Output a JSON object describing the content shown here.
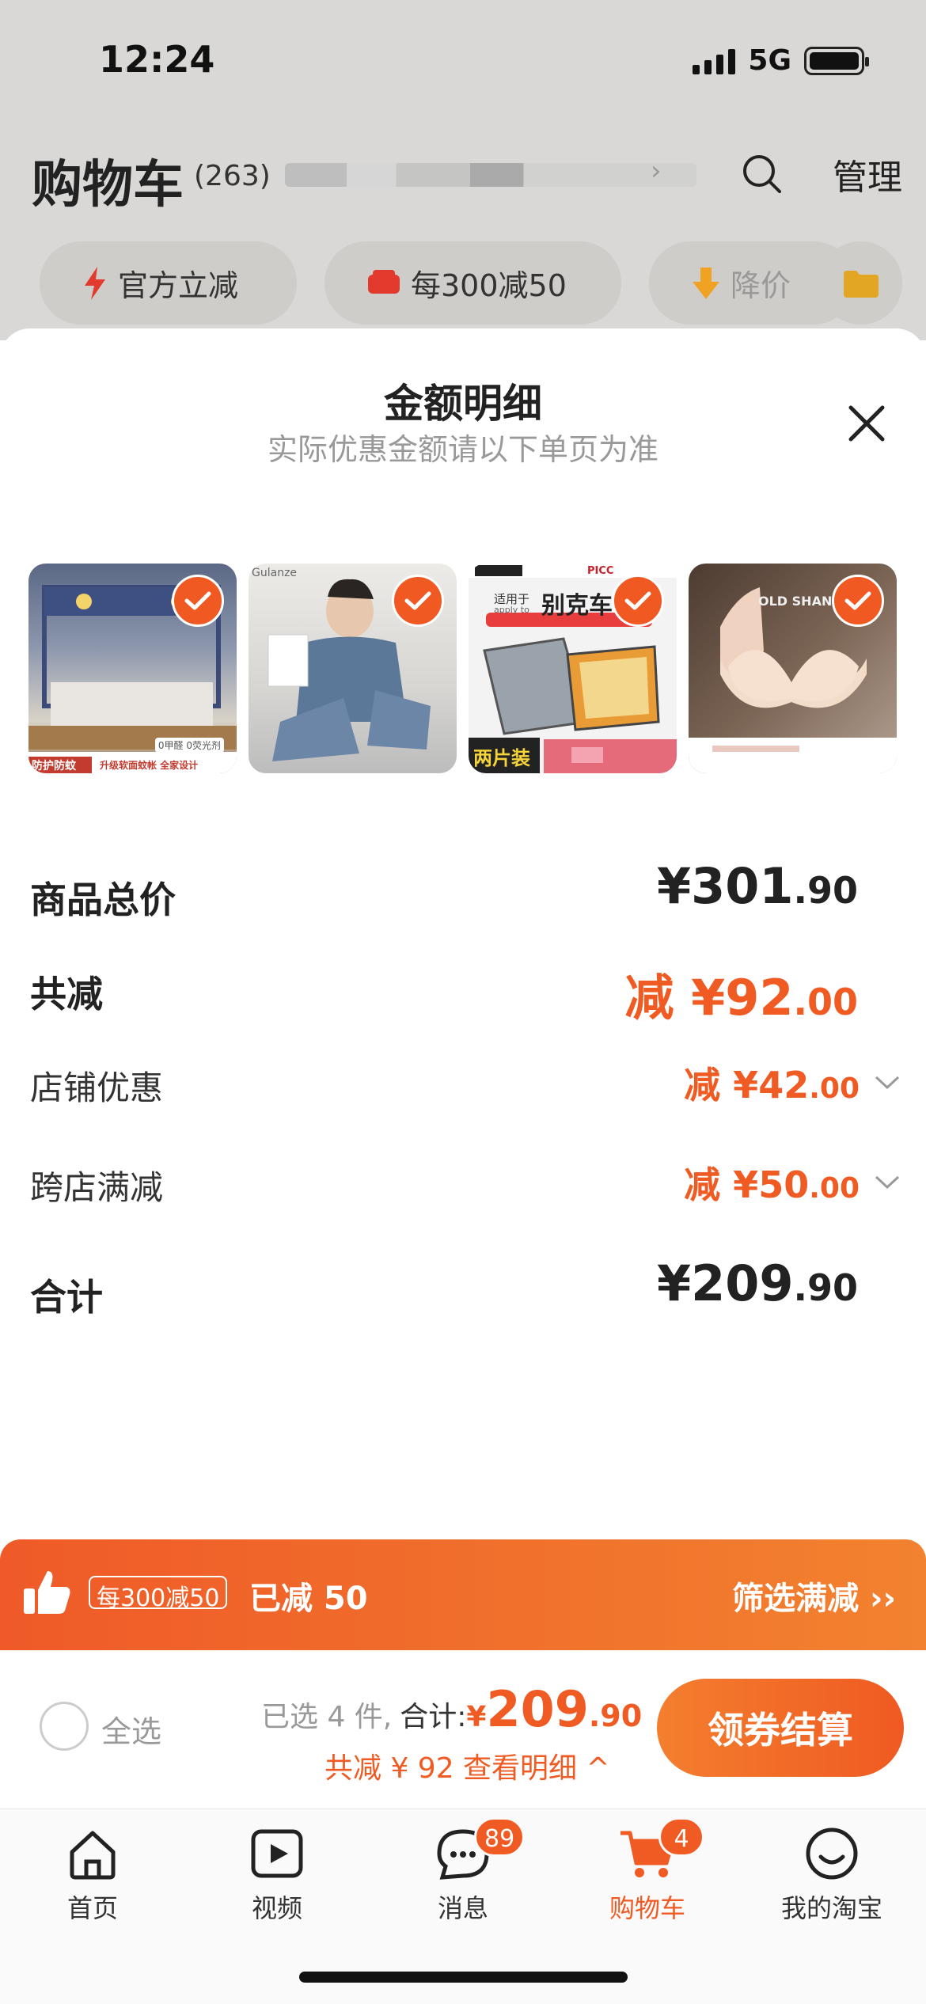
{
  "status_bar": {
    "time": "12:24",
    "network": "5G"
  },
  "cart_header": {
    "title": "购物车",
    "count": "(263)",
    "manage": "管理"
  },
  "chips": [
    {
      "label": "官方立减",
      "icon": "lightning-icon"
    },
    {
      "label": "每300减50",
      "icon": "coupon-icon"
    },
    {
      "label": "降价",
      "icon": "down-arrow-icon"
    }
  ],
  "sheet": {
    "title": "金额明细",
    "subtitle": "实际优惠金额请以下单页为准",
    "products": [
      {
        "name": "mosquito-net",
        "selected": true
      },
      {
        "name": "pajamas",
        "selected": true
      },
      {
        "name": "car-air-filter",
        "selected": true
      },
      {
        "name": "bra",
        "selected": true
      }
    ],
    "product_texts": {
      "p1_badge": "0甲醛 0荧光剂",
      "p1_banner": "防护防蚊",
      "p1_banner2": "升级软面蚊帐 全家设计",
      "p2_text": "Gulanze",
      "p3_apply": "适用于",
      "p3_apply_en": "apply to",
      "p3_title": "别克车",
      "p3_bottom": "两片装",
      "p3_tag": "PICC",
      "p4_text": "OLD SHANGHAI"
    },
    "rows": {
      "total_label": "商品总价",
      "total_int": "¥301",
      "total_dec": ".90",
      "discount_label": "共减",
      "discount_int": "减 ¥92",
      "discount_dec": ".00",
      "shop_label": "店铺优惠",
      "shop_int": "减 ¥42",
      "shop_dec": ".00",
      "cross_label": "跨店满减",
      "cross_int": "减 ¥50",
      "cross_dec": ".00",
      "sum_label": "合计",
      "sum_int": "¥209",
      "sum_dec": ".90"
    }
  },
  "promo": {
    "tag": "每300减50",
    "done": "已减 50",
    "filter": "筛选满减 ››"
  },
  "checkout": {
    "select_all": "全选",
    "selected_count": "已选 4 件,",
    "total_label": "合计:",
    "currency": "¥",
    "total_int": "209",
    "total_dec": ".90",
    "discount_link": "共减 ¥ 92  查看明细 ^",
    "pay_button": "领券结算"
  },
  "tabbar": [
    {
      "label": "首页",
      "icon": "home-icon"
    },
    {
      "label": "视频",
      "icon": "video-icon"
    },
    {
      "label": "消息",
      "icon": "message-icon",
      "badge": "89"
    },
    {
      "label": "购物车",
      "icon": "cart-icon",
      "badge": "4",
      "active": true
    },
    {
      "label": "我的淘宝",
      "icon": "profile-icon"
    }
  ],
  "colors": {
    "accent": "#ef5b23",
    "accent_light": "#f2822f"
  }
}
